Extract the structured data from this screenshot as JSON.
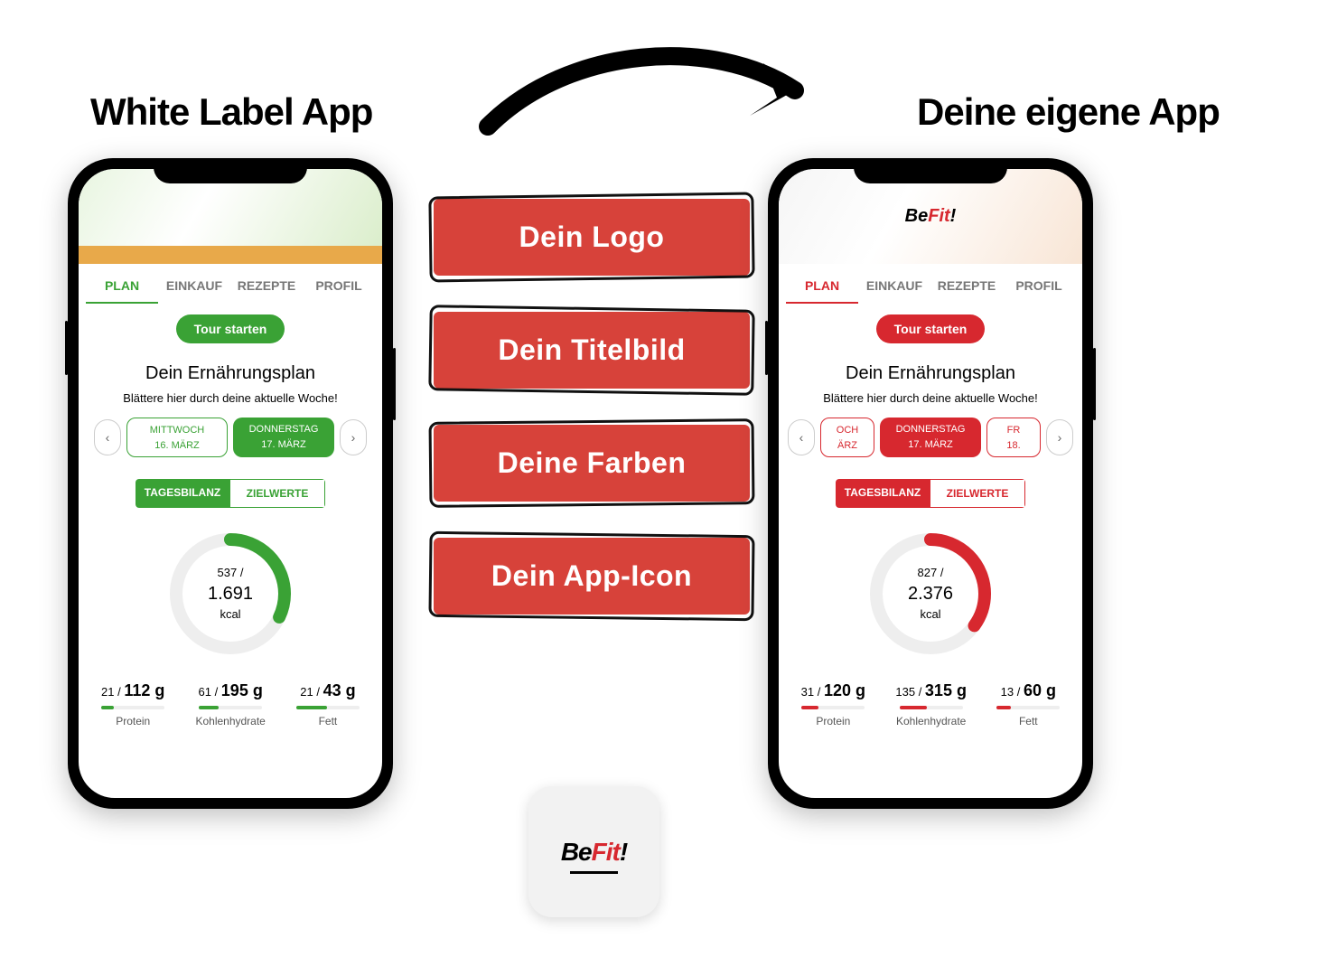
{
  "headings": {
    "left": "White Label App",
    "right": "Deine eigene App"
  },
  "features": [
    "Dein Logo",
    "Dein Titelbild",
    "Deine Farben",
    "Dein App-Icon"
  ],
  "app_icon_brand": {
    "part1": "Be",
    "part2": "Fit",
    "part3": "!"
  },
  "app": {
    "tabs": [
      "PLAN",
      "EINKAUF",
      "REZEPTE",
      "PROFIL"
    ],
    "tour_button": "Tour starten",
    "plan_title": "Dein Ernährungsplan",
    "plan_subtitle": "Blättere hier durch deine aktuelle Woche!",
    "segments": [
      "TAGESBILANZ",
      "ZIELWERTE"
    ],
    "kcal_unit": "kcal",
    "macro_labels": {
      "protein": "Protein",
      "carbs": "Kohlenhydrate",
      "fat": "Fett"
    }
  },
  "phone_left": {
    "accent": "#3aa235",
    "day_prev": {
      "weekday": "MITTWOCH",
      "date": "16. MÄRZ"
    },
    "day_active": {
      "weekday": "DONNERSTAG",
      "date": "17. MÄRZ"
    },
    "kcal": {
      "current": "537 /",
      "target": "1.691"
    },
    "ring_pct": 32,
    "macros": {
      "protein": {
        "current": "21",
        "target": "112 g",
        "pct": 19
      },
      "carbs": {
        "current": "61",
        "target": "195 g",
        "pct": 31
      },
      "fat": {
        "current": "21",
        "target": "43 g",
        "pct": 49
      }
    }
  },
  "phone_right": {
    "accent": "#d7282f",
    "day_prev": {
      "weekday": "OCH",
      "date": "ÄRZ"
    },
    "day_active": {
      "weekday": "DONNERSTAG",
      "date": "17. MÄRZ"
    },
    "day_next": {
      "weekday": "FR",
      "date": "18."
    },
    "kcal": {
      "current": "827 /",
      "target": "2.376"
    },
    "ring_pct": 35,
    "macros": {
      "protein": {
        "current": "31",
        "target": "120 g",
        "pct": 26
      },
      "carbs": {
        "current": "135",
        "target": "315 g",
        "pct": 43
      },
      "fat": {
        "current": "13",
        "target": "60 g",
        "pct": 22
      }
    }
  }
}
